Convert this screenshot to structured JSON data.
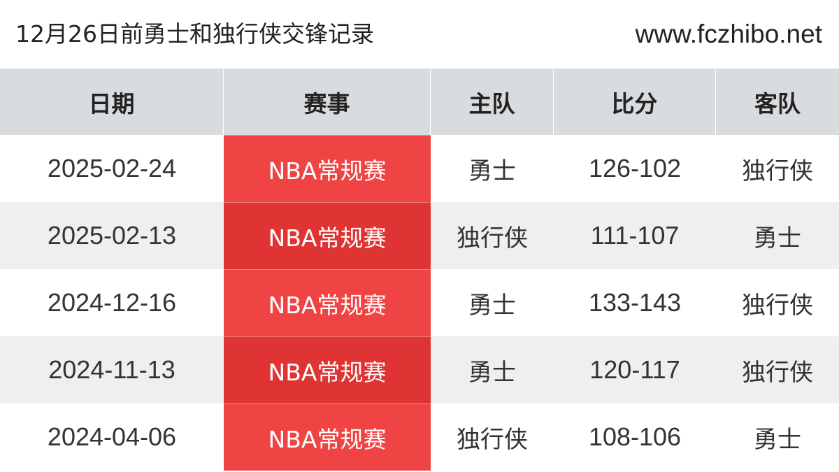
{
  "header": {
    "title": "12月26日前勇士和独行侠交锋记录",
    "site": "www.fczhibo.net"
  },
  "table": {
    "columns": [
      "日期",
      "赛事",
      "主队",
      "比分",
      "客队"
    ],
    "rows": [
      {
        "date": "2025-02-24",
        "match": "NBA常规赛",
        "home": "勇士",
        "score": "126-102",
        "away": "独行侠"
      },
      {
        "date": "2025-02-13",
        "match": "NBA常规赛",
        "home": "独行侠",
        "score": "111-107",
        "away": "勇士"
      },
      {
        "date": "2024-12-16",
        "match": "NBA常规赛",
        "home": "勇士",
        "score": "133-143",
        "away": "独行侠"
      },
      {
        "date": "2024-11-13",
        "match": "NBA常规赛",
        "home": "勇士",
        "score": "120-117",
        "away": "独行侠"
      },
      {
        "date": "2024-04-06",
        "match": "NBA常规赛",
        "home": "独行侠",
        "score": "108-106",
        "away": "勇士"
      }
    ]
  },
  "colors": {
    "header_bg": "#d9dcdf",
    "match_bg": "#f04444",
    "match_bg_alt": "#e03434",
    "row_alt_bg": "#f0eff0"
  }
}
